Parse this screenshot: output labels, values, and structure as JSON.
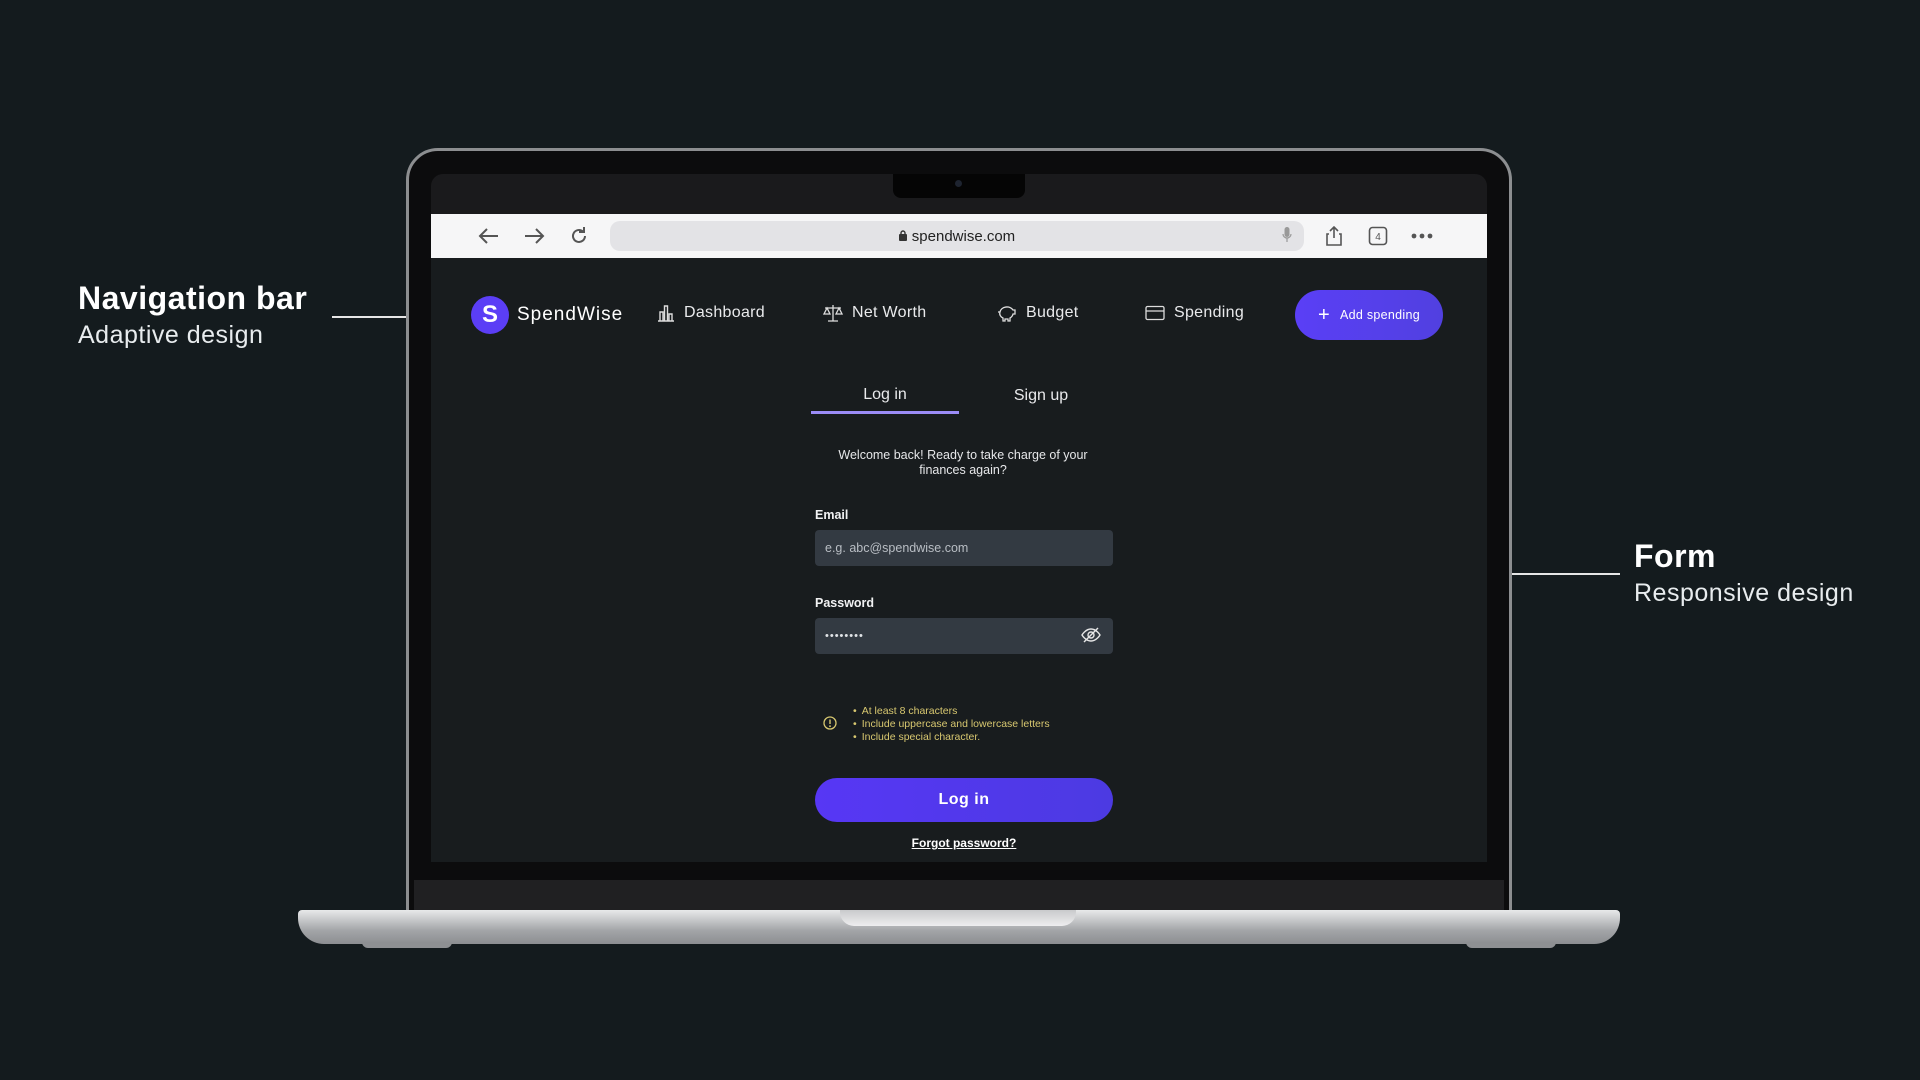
{
  "annotations": {
    "nav": {
      "title": "Navigation bar",
      "subtitle": "Adaptive design"
    },
    "form": {
      "title": "Form",
      "subtitle": "Responsive design"
    }
  },
  "browser": {
    "url": "spendwise.com",
    "tab_count": "4",
    "icons": [
      "back-arrow-icon",
      "forward-arrow-icon",
      "reload-icon",
      "lock-icon",
      "microphone-icon",
      "share-icon",
      "tabs-icon",
      "more-icon"
    ]
  },
  "app": {
    "brand": {
      "initial": "S",
      "name": "SpendWise",
      "color": "#5b3ef6"
    },
    "nav": {
      "dashboard": "Dashboard",
      "net_worth": "Net Worth",
      "budget": "Budget",
      "spending": "Spending",
      "add_spending": "Add spending"
    },
    "tabs": {
      "login": "Log in",
      "signup": "Sign up",
      "active": "login"
    },
    "form": {
      "welcome": "Welcome back! Ready to take charge of your finances again?",
      "email_label": "Email",
      "email_placeholder": "e.g. abc@spendwise.com",
      "password_label": "Password",
      "password_value": "••••••••",
      "hints": [
        "At least 8 characters",
        "Include uppercase and lowercase letters",
        "Include special character."
      ],
      "submit": "Log in",
      "forgot": "Forgot password?"
    },
    "colors": {
      "accent": "#5b3ef6",
      "tab_underline": "#9b8cf7",
      "hint": "#d8c870",
      "background": "#181c1e"
    }
  }
}
